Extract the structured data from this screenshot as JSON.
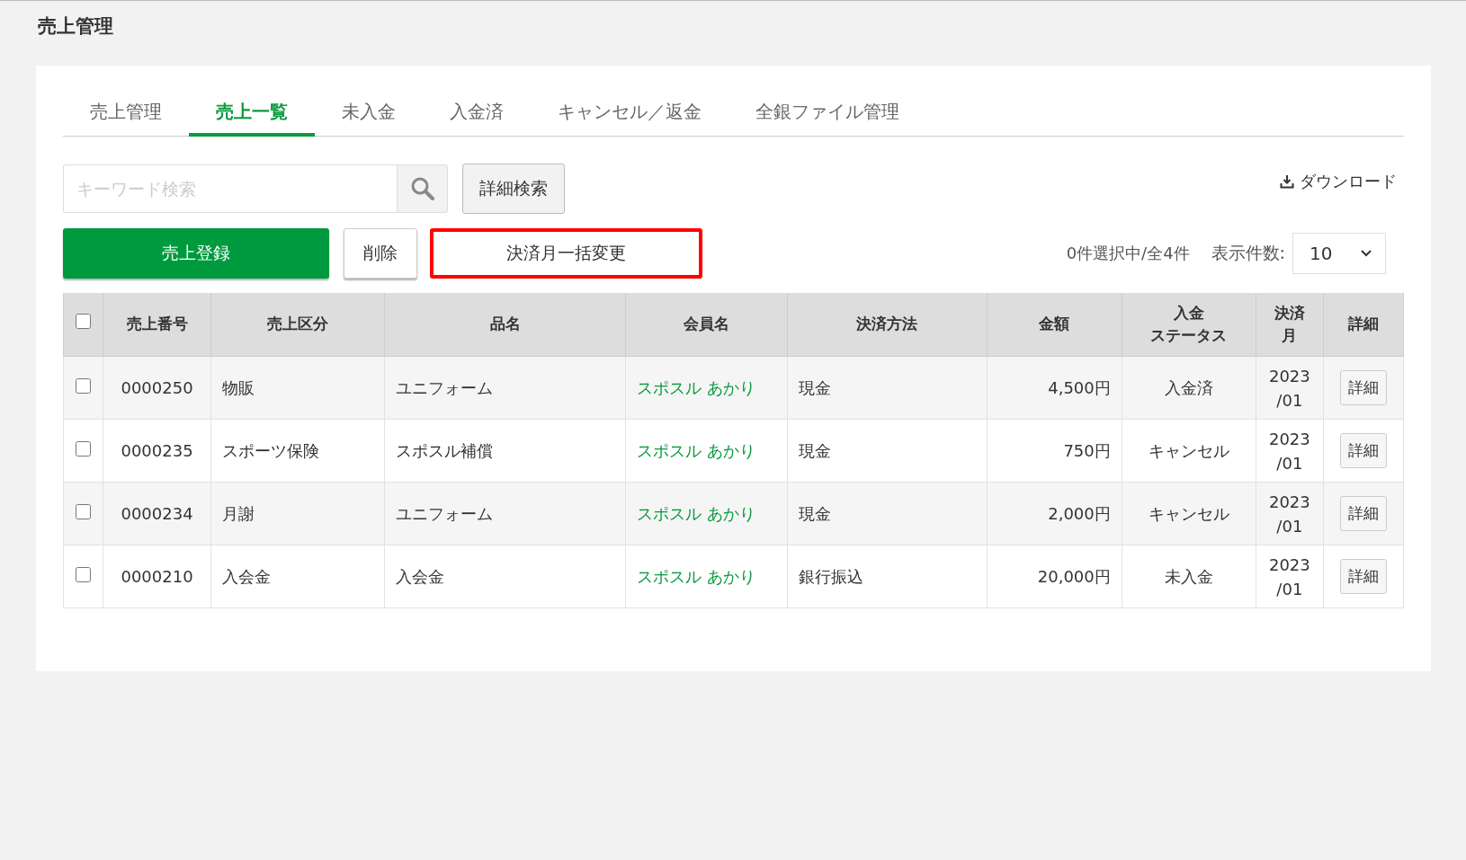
{
  "page_title": "売上管理",
  "tabs": [
    {
      "label": "売上管理",
      "selected": false
    },
    {
      "label": "売上一覧",
      "selected": true
    },
    {
      "label": "未入金",
      "selected": false
    },
    {
      "label": "入金済",
      "selected": false
    },
    {
      "label": "キャンセル／返金",
      "selected": false
    },
    {
      "label": "全銀ファイル管理",
      "selected": false
    }
  ],
  "search": {
    "placeholder": "キーワード検索"
  },
  "detail_search_button": "詳細検索",
  "download_link": "ダウンロード",
  "actions": [
    {
      "label": "売上登録",
      "kind": "primary",
      "highlighted": false
    },
    {
      "label": "削除",
      "kind": "secondary",
      "highlighted": false
    },
    {
      "label": "決済月一括変更",
      "kind": "plain",
      "highlighted": true
    }
  ],
  "selection_count": "0件選択中/全4件",
  "page_size": {
    "label": "表示件数:",
    "value": "10"
  },
  "table": {
    "select_all": {
      "checked": false
    },
    "columns": [
      {
        "lines": [
          "売上番号"
        ]
      },
      {
        "lines": [
          "売上区分"
        ]
      },
      {
        "lines": [
          "品名"
        ]
      },
      {
        "lines": [
          "会員名"
        ]
      },
      {
        "lines": [
          "決済方法"
        ]
      },
      {
        "lines": [
          "金額"
        ]
      },
      {
        "lines": [
          "入金",
          "ステータス"
        ]
      },
      {
        "lines": [
          "決済",
          "月"
        ]
      },
      {
        "lines": [
          "詳細"
        ]
      }
    ],
    "rows": [
      {
        "checked": false,
        "number": "0000250",
        "category": "物販",
        "item": "ユニフォーム",
        "member": "スポスル あかり",
        "method": "現金",
        "amount": "4,500円",
        "status": "入金済",
        "month": "2023\n/01",
        "detail": "詳細"
      },
      {
        "checked": false,
        "number": "0000235",
        "category": "スポーツ保険",
        "item": "スポスル補償",
        "member": "スポスル あかり",
        "method": "現金",
        "amount": "750円",
        "status": "キャンセル",
        "month": "2023\n/01",
        "detail": "詳細"
      },
      {
        "checked": false,
        "number": "0000234",
        "category": "月謝",
        "item": "ユニフォーム",
        "member": "スポスル あかり",
        "method": "現金",
        "amount": "2,000円",
        "status": "キャンセル",
        "month": "2023\n/01",
        "detail": "詳細"
      },
      {
        "checked": false,
        "number": "0000210",
        "category": "入会金",
        "item": "入会金",
        "member": "スポスル あかり",
        "method": "銀行振込",
        "amount": "20,000円",
        "status": "未入金",
        "month": "2023\n/01",
        "detail": "詳細"
      }
    ]
  }
}
